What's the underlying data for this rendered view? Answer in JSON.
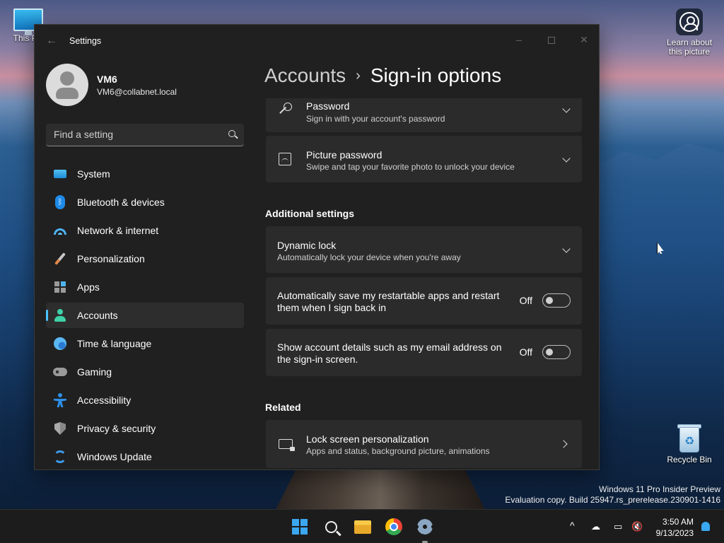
{
  "desktop": {
    "icons": [
      {
        "label": "This PC",
        "icon": "monitor-icon"
      },
      {
        "label": "Learn about this picture",
        "icon": "camera-icon"
      },
      {
        "label": "Recycle Bin",
        "icon": "recycle-bin-icon"
      }
    ],
    "watermark": {
      "line1": "Windows 11 Pro Insider Preview",
      "line2": "Evaluation copy. Build 25947.rs_prerelease.230901-1416"
    }
  },
  "window": {
    "title": "Settings",
    "controls": {
      "minimize": "–",
      "close": "✕"
    }
  },
  "profile": {
    "name": "VM6",
    "email": "VM6@collabnet.local"
  },
  "search": {
    "placeholder": "Find a setting"
  },
  "sidebar": {
    "items": [
      {
        "label": "System",
        "icon": "system-icon"
      },
      {
        "label": "Bluetooth & devices",
        "icon": "bluetooth-icon"
      },
      {
        "label": "Network & internet",
        "icon": "wifi-icon"
      },
      {
        "label": "Personalization",
        "icon": "brush-icon"
      },
      {
        "label": "Apps",
        "icon": "apps-icon"
      },
      {
        "label": "Accounts",
        "icon": "accounts-icon",
        "active": true
      },
      {
        "label": "Time & language",
        "icon": "globe-clock-icon"
      },
      {
        "label": "Gaming",
        "icon": "controller-icon"
      },
      {
        "label": "Accessibility",
        "icon": "accessibility-icon"
      },
      {
        "label": "Privacy & security",
        "icon": "shield-icon"
      },
      {
        "label": "Windows Update",
        "icon": "update-icon"
      }
    ],
    "accent": "#4cc2ff"
  },
  "breadcrumb": {
    "parent": "Accounts",
    "separator": "›",
    "current": "Sign-in options"
  },
  "main": {
    "sign_in_cards": [
      {
        "title": "Password",
        "subtitle": "Sign in with your account's password",
        "icon": "key-icon"
      },
      {
        "title": "Picture password",
        "subtitle": "Swipe and tap your favorite photo to unlock your device",
        "icon": "picture-icon"
      }
    ],
    "additional_settings": {
      "heading": "Additional settings",
      "dynamic_lock": {
        "title": "Dynamic lock",
        "subtitle": "Automatically lock your device when you're away"
      },
      "restart_apps": {
        "line1": "Automatically save my restartable apps and restart",
        "line2": "them when I sign back in",
        "state": "Off"
      },
      "account_details": {
        "line1": "Show account details such as my email address on",
        "line2": "the sign-in screen.",
        "state": "Off"
      }
    },
    "related": {
      "heading": "Related",
      "lock_screen": {
        "title": "Lock screen personalization",
        "subtitle": "Apps and status, background picture, animations",
        "icon": "lock-screen-icon"
      }
    }
  },
  "taskbar": {
    "apps": [
      "start-icon",
      "search-icon",
      "file-explorer-icon",
      "chrome-icon",
      "settings-icon"
    ],
    "tray": {
      "chevron": "^",
      "time": "3:50 AM",
      "date": "9/13/2023"
    }
  }
}
